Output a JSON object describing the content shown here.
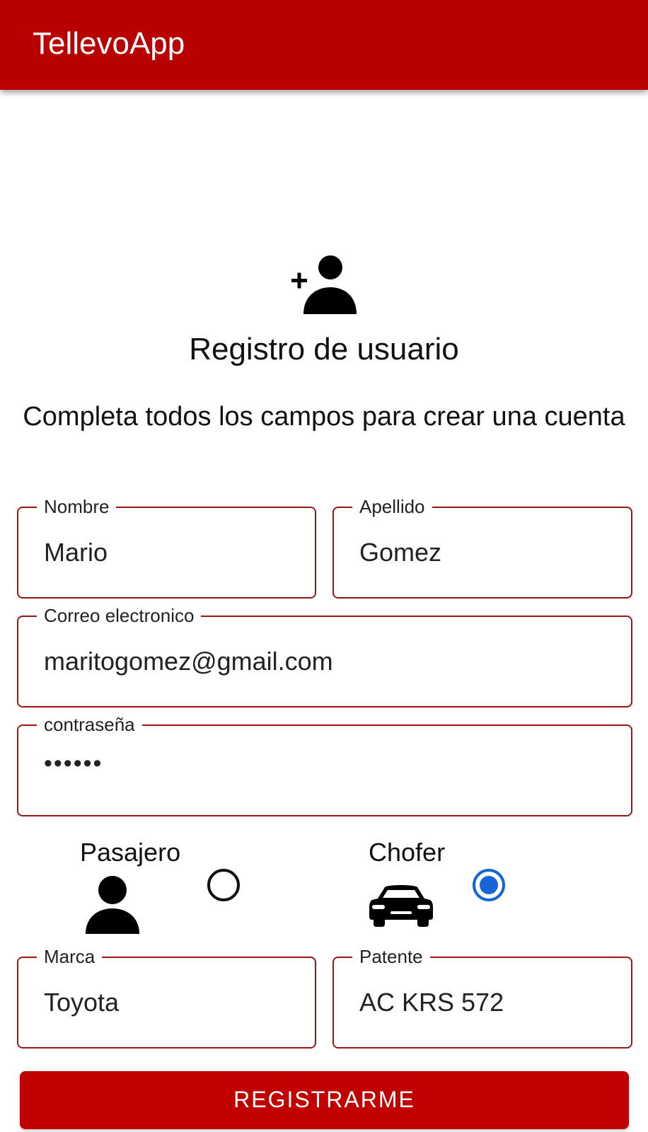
{
  "app_bar": {
    "title": "TellevoApp",
    "color": "#b80000"
  },
  "header": {
    "icon": "person-add-icon",
    "title": "Registro de usuario",
    "subtitle": "Completa todos los campos para crear una cuenta"
  },
  "form": {
    "nombre": {
      "label": "Nombre",
      "value": "Mario"
    },
    "apellido": {
      "label": "Apellido",
      "value": "Gomez"
    },
    "correo": {
      "label": "Correo electronico",
      "value": "maritogomez@gmail.com"
    },
    "contrasena": {
      "label": "contraseña",
      "value": "••••••"
    },
    "marca": {
      "label": "Marca",
      "value": "Toyota"
    },
    "patente": {
      "label": "Patente",
      "value": "AC KRS 572"
    },
    "field_border_color": "#9a1717"
  },
  "role": {
    "pasajero": {
      "label": "Pasajero",
      "icon": "person-icon",
      "selected": false
    },
    "chofer": {
      "label": "Chofer",
      "icon": "car-icon",
      "selected": true
    },
    "selected_color": "#1565d8"
  },
  "submit": {
    "label": "REGISTRARME",
    "color": "#c10000"
  }
}
